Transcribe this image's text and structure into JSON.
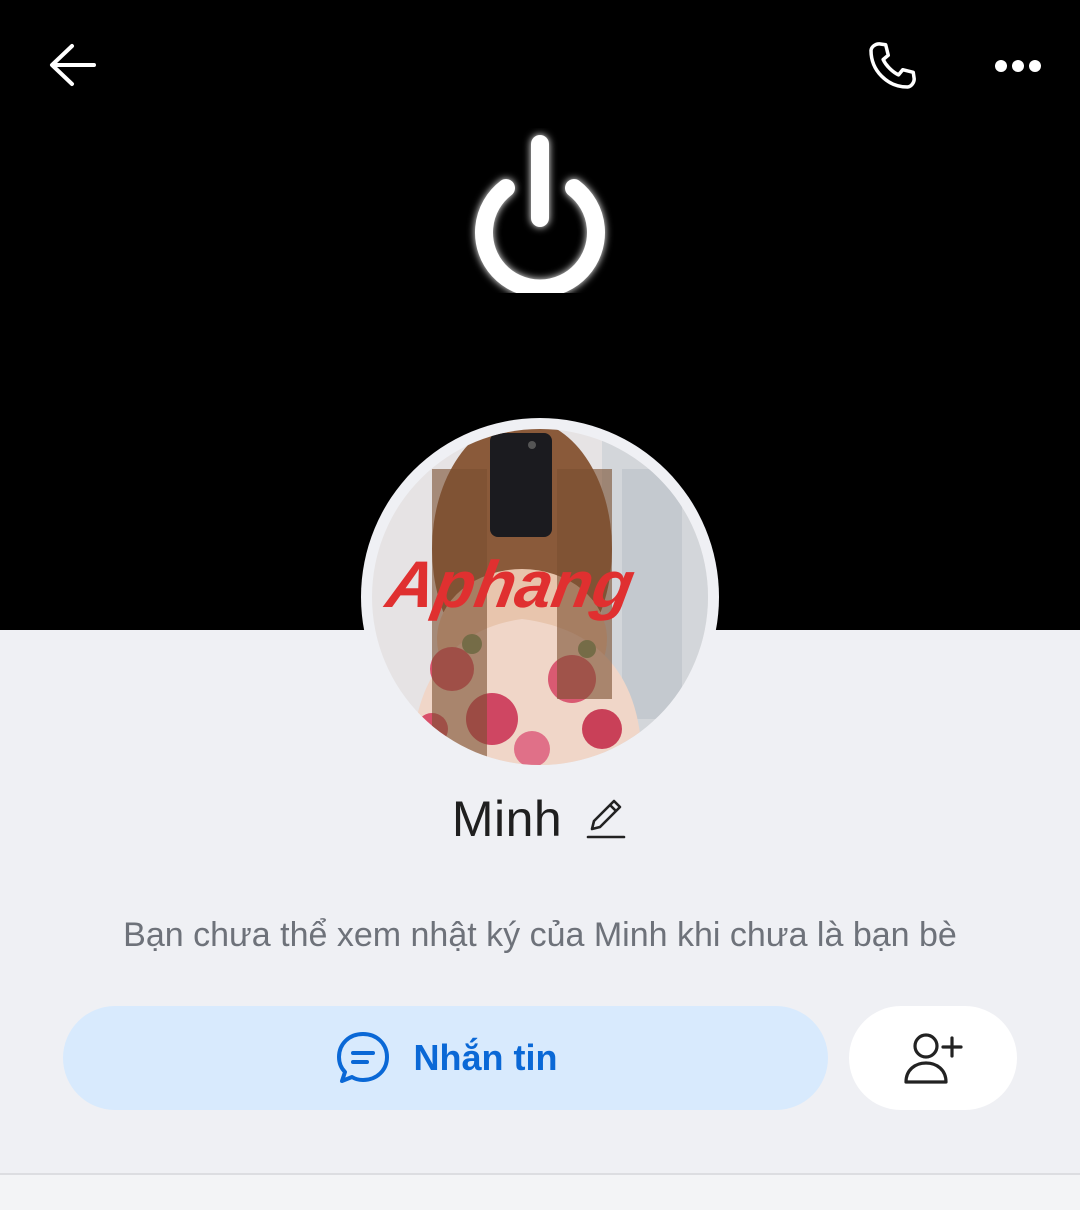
{
  "header": {
    "back_icon": "arrow-left-icon",
    "call_icon": "phone-icon",
    "more_icon": "more-horizontal-icon"
  },
  "cover": {
    "image": "power-symbol-glow",
    "background": "#000000"
  },
  "profile": {
    "name": "Minh",
    "edit_icon": "pencil-icon",
    "avatar_image": "profile-photo",
    "avatar_watermark": "Aphang"
  },
  "notice": "Bạn chưa thể xem nhật ký của Minh khi chưa là bạn bè",
  "actions": {
    "message_label": "Nhắn tin",
    "message_icon": "chat-bubble-icon",
    "add_friend_icon": "add-user-icon"
  },
  "colors": {
    "accent": "#0a68d6",
    "message_button_bg": "#d8eafd",
    "page_bg": "#eff0f4"
  }
}
